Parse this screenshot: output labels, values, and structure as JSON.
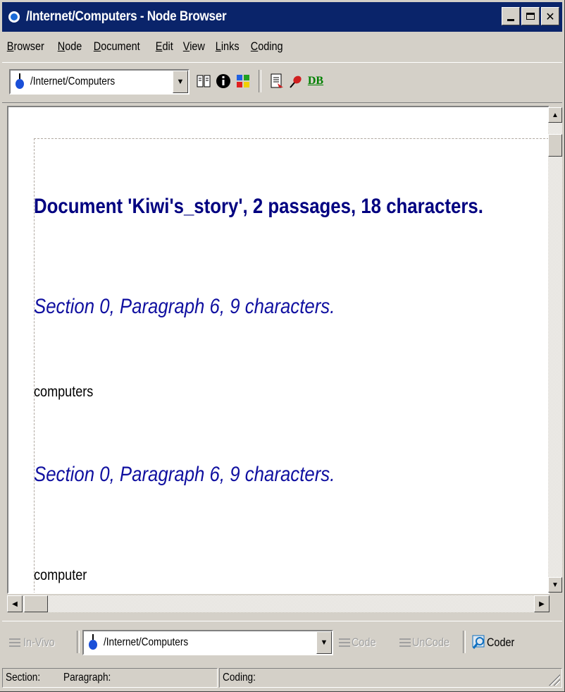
{
  "window": {
    "title": "/Internet/Computers - Node Browser"
  },
  "menu": {
    "items": [
      {
        "first": "B",
        "rest": "rowser"
      },
      {
        "first": "N",
        "rest": "ode"
      },
      {
        "first": "D",
        "rest": "ocument"
      },
      {
        "first": "E",
        "rest": "dit"
      },
      {
        "first": "V",
        "rest": "iew"
      },
      {
        "first": "L",
        "rest": "inks"
      },
      {
        "first": "C",
        "rest": "oding"
      }
    ]
  },
  "toolbar": {
    "node_path": "/Internet/Computers",
    "db_label": "DB"
  },
  "document": {
    "heading": "Document 'Kiwi's_story',  2 passages, 18 characters.",
    "passages": [
      {
        "heading": "Section 0, Paragraph 6, 9 characters.",
        "text": "computers"
      },
      {
        "heading": "Section 0, Paragraph 6, 9 characters.",
        "text": "computer"
      }
    ]
  },
  "coding_bar": {
    "invivo_label": "In-Vivo",
    "node_path": "/Internet/Computers",
    "code_label": "Code",
    "uncode_label": "UnCode",
    "coder_label": "Coder"
  },
  "status": {
    "section_label": "Section:",
    "paragraph_label": "Paragraph:",
    "coding_label": "Coding:"
  },
  "colors": {
    "title_bar": "#0a246a",
    "heading": "#000080",
    "section_heading": "#1010a0"
  }
}
